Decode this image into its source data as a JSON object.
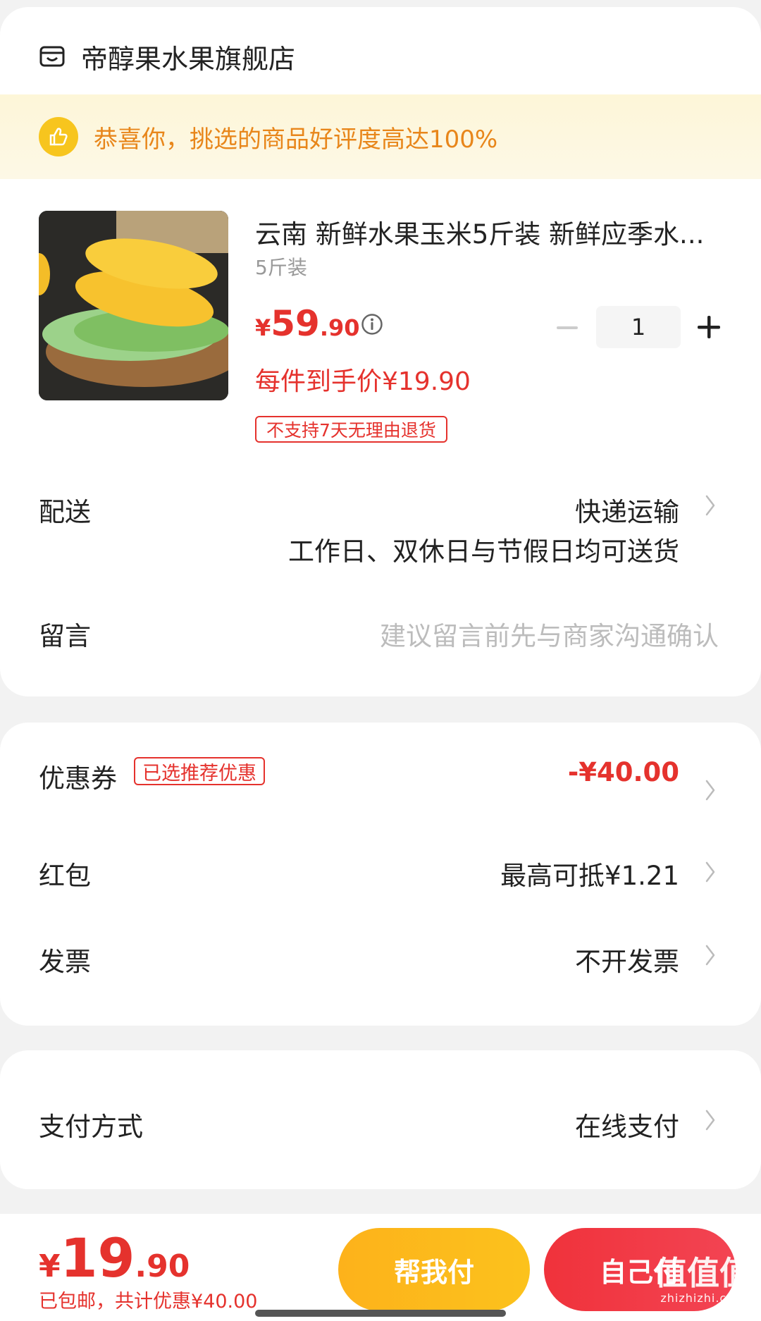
{
  "store": {
    "name": "帝醇果水果旗舰店",
    "icon": "store-icon"
  },
  "banner": {
    "text": "恭喜你，挑选的商品好评度高达100%",
    "icon": "thumbs-up-icon",
    "accent": "#e8861a"
  },
  "product": {
    "title": "云南 新鲜水果玉米5斤装 新鲜应季水...",
    "spec": "5斤装",
    "price_symbol": "¥",
    "price_int": "59",
    "price_dec": ".90",
    "quantity": "1",
    "unit_price_label": "每件到手价¥19.90",
    "policy_tag": "不支持7天无理由退货"
  },
  "delivery": {
    "label": "配送",
    "method": "快递运输",
    "note": "工作日、双休日与节假日均可送货"
  },
  "message": {
    "label": "留言",
    "placeholder": "建议留言前先与商家沟通确认"
  },
  "discounts": {
    "coupon_label": "优惠券",
    "coupon_tag": "已选推荐优惠",
    "coupon_value": "-¥40.00",
    "redpacket_label": "红包",
    "redpacket_value": "最高可抵¥1.21",
    "invoice_label": "发票",
    "invoice_value": "不开发票"
  },
  "payment": {
    "label": "支付方式",
    "value": "在线支付"
  },
  "footer": {
    "total_symbol": "¥",
    "total_int": "19",
    "total_dec": ".90",
    "note": "已包邮，共计优惠¥40.00",
    "help_pay": "帮我付",
    "self_pay": "自己付",
    "watermark": "值值值",
    "watermark_sub": "zhizhizhi.com"
  },
  "colors": {
    "price_red": "#e5322d",
    "help_btn": "#fdb21b",
    "self_btn": "#f0323b"
  }
}
